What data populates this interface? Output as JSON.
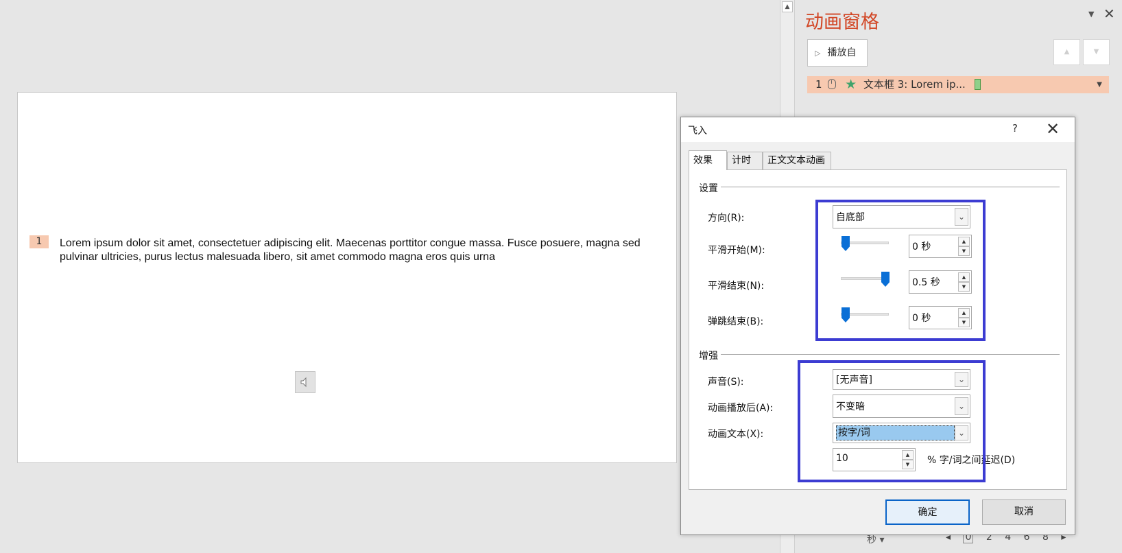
{
  "slide": {
    "number": "1",
    "text": "Lorem ipsum dolor sit amet, consectetuer adipiscing elit. Maecenas porttitor congue massa. Fusce posuere, magna sed pulvinar ultricies, purus lectus malesuada libero, sit amet commodo magna eros quis urna"
  },
  "pane": {
    "title": "动画窗格",
    "menu_icon": "dropdown-triangle-icon",
    "close_icon": "close-icon",
    "play_label": "播放自",
    "item": {
      "number": "1",
      "label": "文本框 3: Lorem ip...",
      "effect_color": "#3fa36b"
    },
    "seconds_label": "秒",
    "timeline_ticks": [
      "0",
      "2",
      "4",
      "6",
      "8"
    ]
  },
  "dialog": {
    "title": "飞入",
    "help": "?",
    "tabs": [
      "效果",
      "计时",
      "正文文本动画"
    ],
    "settings": {
      "group": "设置",
      "direction_label": "方向(R):",
      "direction_value": "自底部",
      "smooth_start_label": "平滑开始(M):",
      "smooth_start_value": "0 秒",
      "smooth_start_fraction": 0,
      "smooth_end_label": "平滑结束(N):",
      "smooth_end_value": "0.5 秒",
      "smooth_end_fraction": 1,
      "bounce_end_label": "弹跳结束(B):",
      "bounce_end_value": "0 秒",
      "bounce_end_fraction": 0
    },
    "enhance": {
      "group": "增强",
      "sound_label": "声音(S):",
      "sound_value": "[无声音]",
      "after_label": "动画播放后(A):",
      "after_value": "不变暗",
      "animate_text_label": "动画文本(X):",
      "animate_text_value": "按字/词",
      "delay_value": "10",
      "delay_suffix": "% 字/词之间延迟(D)"
    },
    "ok": "确定",
    "cancel": "取消"
  },
  "colors": {
    "title_red": "#d24726",
    "highlight_box": "#3c3cd2",
    "accent_blue": "#0a6fd6",
    "selection": "#f7c9b0"
  }
}
